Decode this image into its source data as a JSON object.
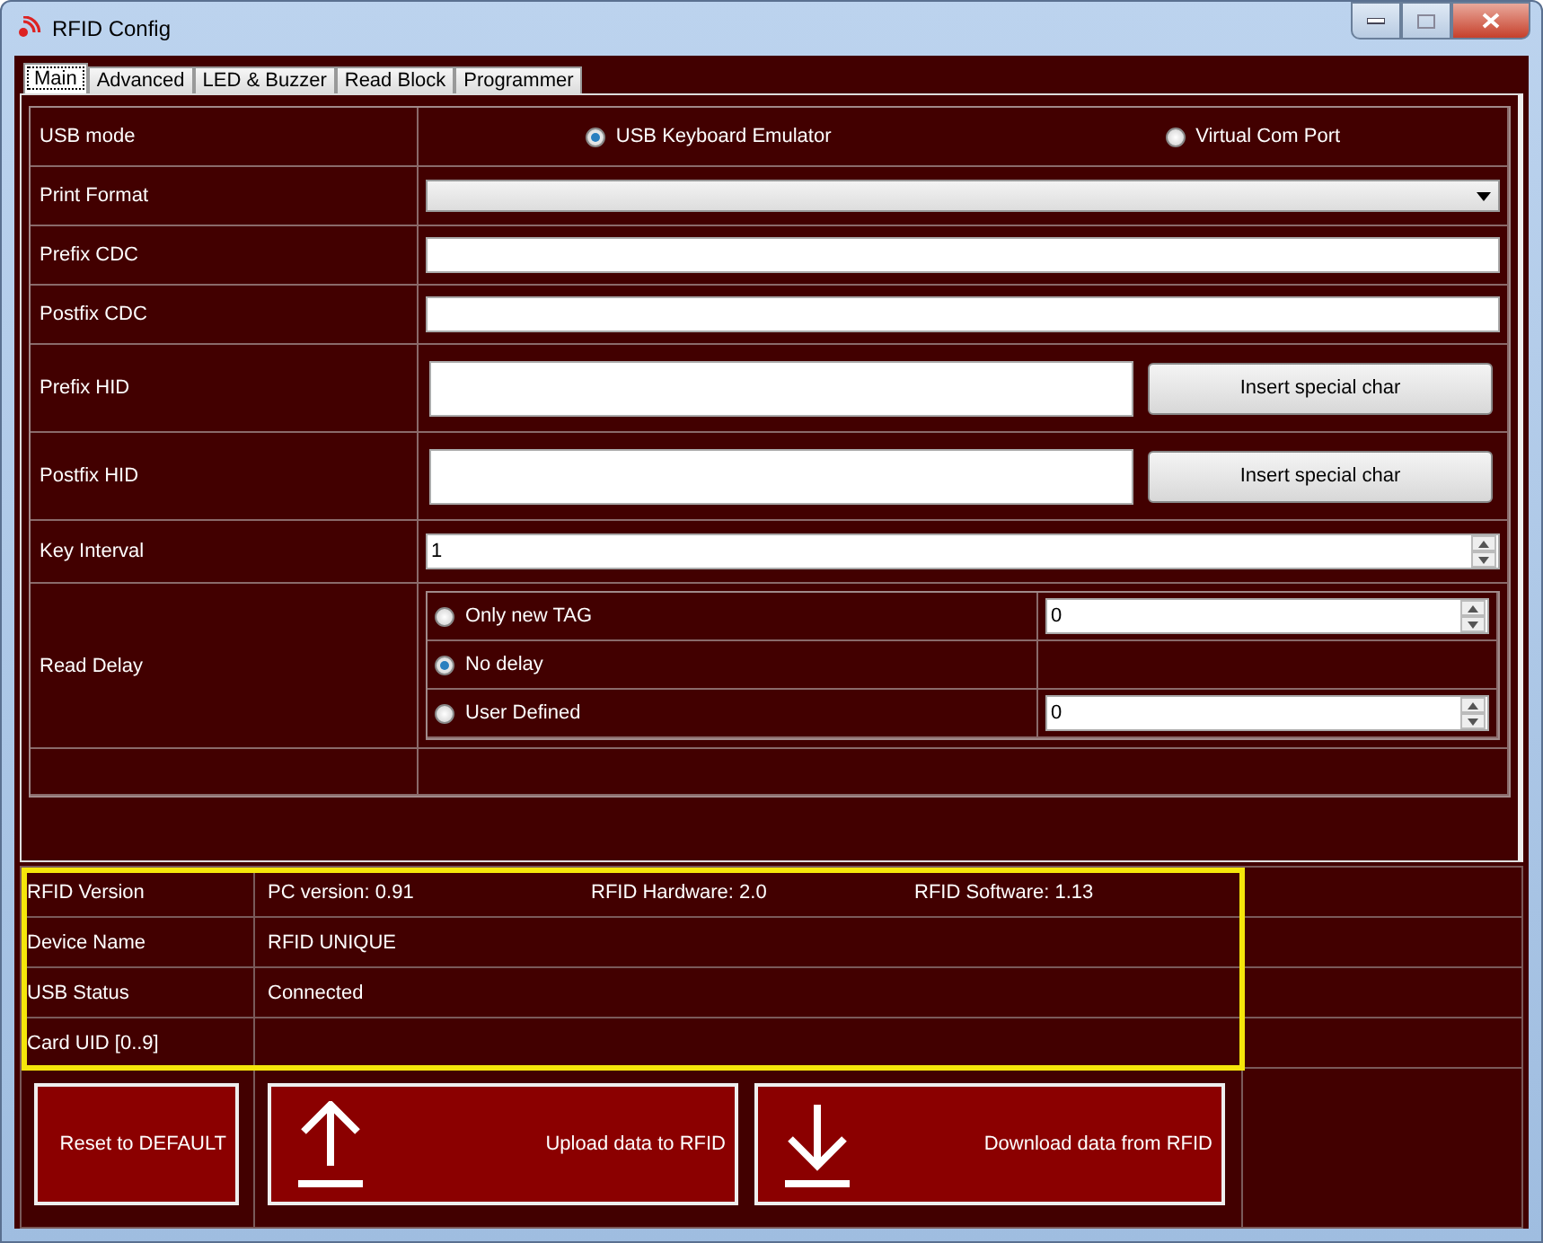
{
  "window": {
    "title": "RFID Config"
  },
  "tabs": [
    {
      "label": "Main",
      "selected": true
    },
    {
      "label": "Advanced",
      "selected": false
    },
    {
      "label": "LED & Buzzer",
      "selected": false
    },
    {
      "label": "Read Block",
      "selected": false
    },
    {
      "label": "Programmer",
      "selected": false
    }
  ],
  "rows": [
    {
      "kind": "radio",
      "label": "USB mode",
      "options": [
        {
          "label": "USB Keyboard Emulator",
          "selected": true
        },
        {
          "label": "Virtual Com Port",
          "selected": false
        }
      ]
    },
    {
      "kind": "dropdown",
      "label": "Print Format"
    },
    {
      "kind": "text",
      "label": "Prefix CDC"
    },
    {
      "kind": "text",
      "label": "Postfix CDC"
    },
    {
      "kind": "text_button",
      "label": "Prefix HID",
      "button": "Insert special char"
    },
    {
      "kind": "text_button",
      "label": "Postfix HID",
      "button": "Insert special char"
    },
    {
      "kind": "spin",
      "label": "Key Interval",
      "value": "1"
    },
    {
      "kind": "read_delay",
      "label": "Read Delay",
      "options": [
        {
          "label": "Only new TAG",
          "selected": false,
          "value": "0"
        },
        {
          "label": "No delay",
          "selected": true
        },
        {
          "label": "User Defined",
          "selected": false,
          "value": "0"
        }
      ]
    }
  ],
  "info": {
    "highlighted": true,
    "rows": [
      {
        "label": "RFID Version",
        "values": [
          "PC version: 0.91",
          "RFID Hardware: 2.0",
          "RFID Software: 1.13"
        ]
      },
      {
        "label": "Device Name",
        "values": [
          "RFID UNIQUE"
        ]
      },
      {
        "label": "USB Status",
        "values": [
          "Connected"
        ]
      },
      {
        "label": "Card UID [0..9]"
      }
    ]
  },
  "buttons": [
    {
      "kind": "plain",
      "label": "Reset to DEFAULT"
    },
    {
      "kind": "upload",
      "label": "Upload data to RFID"
    },
    {
      "kind": "download",
      "label": "Download data from RFID"
    }
  ]
}
